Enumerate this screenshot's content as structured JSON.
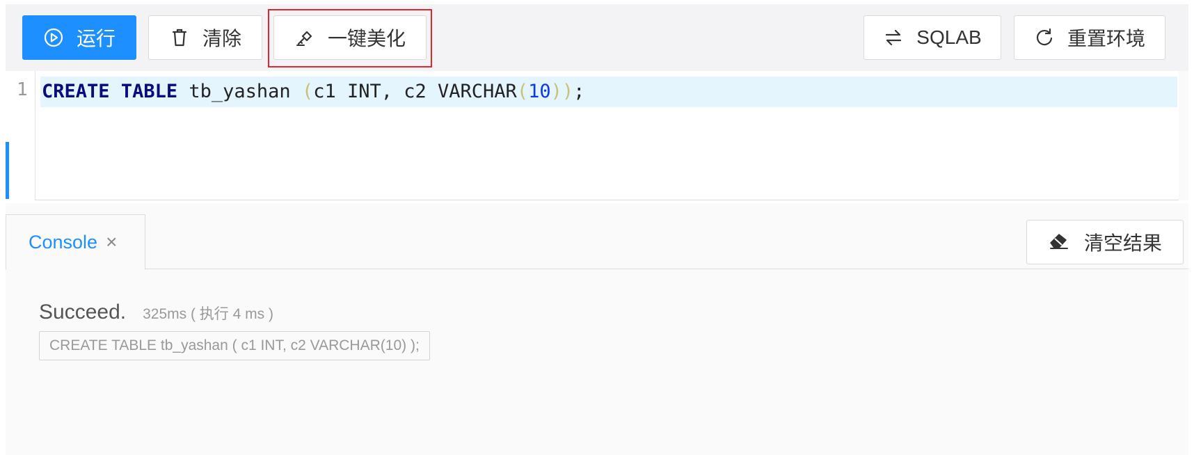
{
  "toolbar": {
    "run_label": "运行",
    "clear_label": "清除",
    "beautify_label": "一键美化",
    "sqlab_label": "SQLAB",
    "reset_label": "重置环境",
    "icons": {
      "run": "play-circle-icon",
      "clear": "trash-icon",
      "beautify": "magic-brush-icon",
      "sqlab": "swap-arrows-icon",
      "reset": "reload-icon"
    },
    "accent_color": "#1e8fff",
    "highlight_color": "#e3262b"
  },
  "editor": {
    "line_number": "1",
    "code": {
      "kw1": "CREATE",
      "kw2": "TABLE",
      "ident": "tb_yashan",
      "open_paren": "(",
      "cols": "c1 INT, c2 VARCHAR",
      "inner_open": "(",
      "size": "10",
      "close_parens": "))",
      "terminator": ";"
    }
  },
  "panel": {
    "tab_label": "Console",
    "tab_close": "×",
    "clear_results_label": "清空结果",
    "clear_results_icon": "eraser-icon"
  },
  "result": {
    "status": "Succeed.",
    "timing": "325ms ( 执行 4 ms )",
    "sql": "CREATE TABLE tb_yashan ( c1 INT, c2 VARCHAR(10) );"
  }
}
